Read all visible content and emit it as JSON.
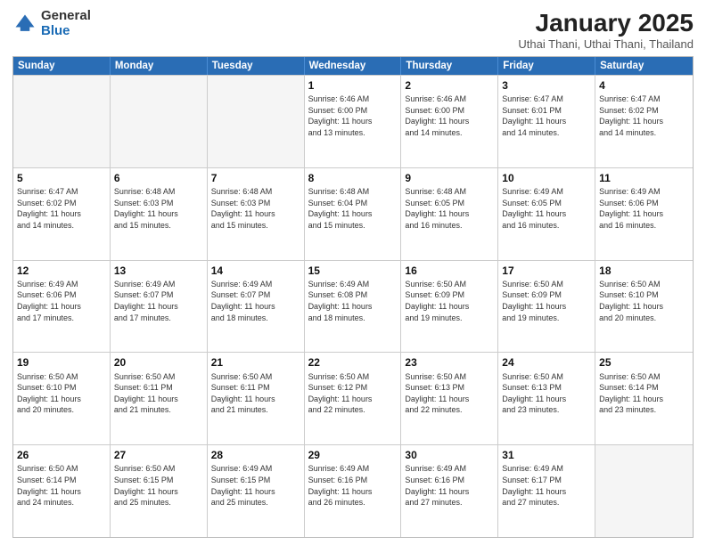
{
  "logo": {
    "general": "General",
    "blue": "Blue"
  },
  "title": {
    "month": "January 2025",
    "location": "Uthai Thani, Uthai Thani, Thailand"
  },
  "calendar": {
    "headers": [
      "Sunday",
      "Monday",
      "Tuesday",
      "Wednesday",
      "Thursday",
      "Friday",
      "Saturday"
    ],
    "rows": [
      [
        {
          "day": "",
          "info": "",
          "empty": true
        },
        {
          "day": "",
          "info": "",
          "empty": true
        },
        {
          "day": "",
          "info": "",
          "empty": true
        },
        {
          "day": "1",
          "info": "Sunrise: 6:46 AM\nSunset: 6:00 PM\nDaylight: 11 hours\nand 13 minutes."
        },
        {
          "day": "2",
          "info": "Sunrise: 6:46 AM\nSunset: 6:00 PM\nDaylight: 11 hours\nand 14 minutes."
        },
        {
          "day": "3",
          "info": "Sunrise: 6:47 AM\nSunset: 6:01 PM\nDaylight: 11 hours\nand 14 minutes."
        },
        {
          "day": "4",
          "info": "Sunrise: 6:47 AM\nSunset: 6:02 PM\nDaylight: 11 hours\nand 14 minutes."
        }
      ],
      [
        {
          "day": "5",
          "info": "Sunrise: 6:47 AM\nSunset: 6:02 PM\nDaylight: 11 hours\nand 14 minutes."
        },
        {
          "day": "6",
          "info": "Sunrise: 6:48 AM\nSunset: 6:03 PM\nDaylight: 11 hours\nand 15 minutes."
        },
        {
          "day": "7",
          "info": "Sunrise: 6:48 AM\nSunset: 6:03 PM\nDaylight: 11 hours\nand 15 minutes."
        },
        {
          "day": "8",
          "info": "Sunrise: 6:48 AM\nSunset: 6:04 PM\nDaylight: 11 hours\nand 15 minutes."
        },
        {
          "day": "9",
          "info": "Sunrise: 6:48 AM\nSunset: 6:05 PM\nDaylight: 11 hours\nand 16 minutes."
        },
        {
          "day": "10",
          "info": "Sunrise: 6:49 AM\nSunset: 6:05 PM\nDaylight: 11 hours\nand 16 minutes."
        },
        {
          "day": "11",
          "info": "Sunrise: 6:49 AM\nSunset: 6:06 PM\nDaylight: 11 hours\nand 16 minutes."
        }
      ],
      [
        {
          "day": "12",
          "info": "Sunrise: 6:49 AM\nSunset: 6:06 PM\nDaylight: 11 hours\nand 17 minutes."
        },
        {
          "day": "13",
          "info": "Sunrise: 6:49 AM\nSunset: 6:07 PM\nDaylight: 11 hours\nand 17 minutes."
        },
        {
          "day": "14",
          "info": "Sunrise: 6:49 AM\nSunset: 6:07 PM\nDaylight: 11 hours\nand 18 minutes."
        },
        {
          "day": "15",
          "info": "Sunrise: 6:49 AM\nSunset: 6:08 PM\nDaylight: 11 hours\nand 18 minutes."
        },
        {
          "day": "16",
          "info": "Sunrise: 6:50 AM\nSunset: 6:09 PM\nDaylight: 11 hours\nand 19 minutes."
        },
        {
          "day": "17",
          "info": "Sunrise: 6:50 AM\nSunset: 6:09 PM\nDaylight: 11 hours\nand 19 minutes."
        },
        {
          "day": "18",
          "info": "Sunrise: 6:50 AM\nSunset: 6:10 PM\nDaylight: 11 hours\nand 20 minutes."
        }
      ],
      [
        {
          "day": "19",
          "info": "Sunrise: 6:50 AM\nSunset: 6:10 PM\nDaylight: 11 hours\nand 20 minutes."
        },
        {
          "day": "20",
          "info": "Sunrise: 6:50 AM\nSunset: 6:11 PM\nDaylight: 11 hours\nand 21 minutes."
        },
        {
          "day": "21",
          "info": "Sunrise: 6:50 AM\nSunset: 6:11 PM\nDaylight: 11 hours\nand 21 minutes."
        },
        {
          "day": "22",
          "info": "Sunrise: 6:50 AM\nSunset: 6:12 PM\nDaylight: 11 hours\nand 22 minutes."
        },
        {
          "day": "23",
          "info": "Sunrise: 6:50 AM\nSunset: 6:13 PM\nDaylight: 11 hours\nand 22 minutes."
        },
        {
          "day": "24",
          "info": "Sunrise: 6:50 AM\nSunset: 6:13 PM\nDaylight: 11 hours\nand 23 minutes."
        },
        {
          "day": "25",
          "info": "Sunrise: 6:50 AM\nSunset: 6:14 PM\nDaylight: 11 hours\nand 23 minutes."
        }
      ],
      [
        {
          "day": "26",
          "info": "Sunrise: 6:50 AM\nSunset: 6:14 PM\nDaylight: 11 hours\nand 24 minutes."
        },
        {
          "day": "27",
          "info": "Sunrise: 6:50 AM\nSunset: 6:15 PM\nDaylight: 11 hours\nand 25 minutes."
        },
        {
          "day": "28",
          "info": "Sunrise: 6:49 AM\nSunset: 6:15 PM\nDaylight: 11 hours\nand 25 minutes."
        },
        {
          "day": "29",
          "info": "Sunrise: 6:49 AM\nSunset: 6:16 PM\nDaylight: 11 hours\nand 26 minutes."
        },
        {
          "day": "30",
          "info": "Sunrise: 6:49 AM\nSunset: 6:16 PM\nDaylight: 11 hours\nand 27 minutes."
        },
        {
          "day": "31",
          "info": "Sunrise: 6:49 AM\nSunset: 6:17 PM\nDaylight: 11 hours\nand 27 minutes."
        },
        {
          "day": "",
          "info": "",
          "empty": true
        }
      ]
    ]
  }
}
